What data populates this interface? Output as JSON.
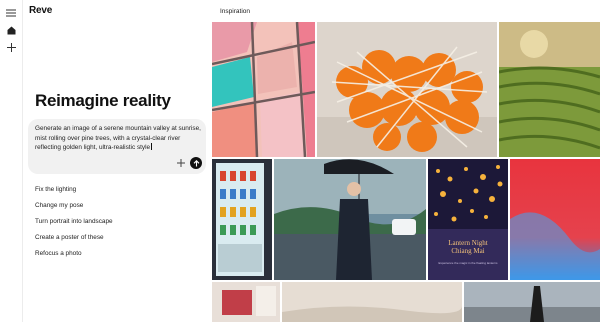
{
  "app": {
    "brand": "Reve"
  },
  "nav": {
    "menu_icon": "menu-icon",
    "home_icon": "home-icon",
    "new_icon": "plus-icon"
  },
  "main": {
    "heading": "Reimagine reality",
    "prompt": {
      "value": "Generate an image of a serene mountain valley at sunrise, mist rolling over pine trees, with a crystal-clear river reflecting golden light, ultra-realistic style"
    },
    "suggestions": [
      "Fix the lighting",
      "Change my pose",
      "Turn portrait into landscape",
      "Create a poster of these",
      "Refocus a photo"
    ]
  },
  "inspiration": {
    "title": "Inspiration",
    "poster": {
      "title_line1": "Lantern Night",
      "title_line2": "Chiang Mai",
      "subtitle": "Experience the magic in the floating lanterns"
    }
  },
  "colors": {
    "accent": "#111111",
    "prompt_bg": "#f1f1f1"
  }
}
